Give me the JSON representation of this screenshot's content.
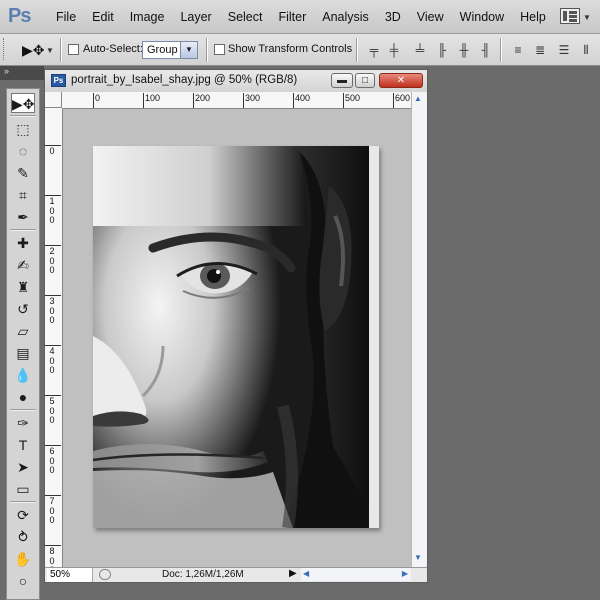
{
  "app": {
    "logo": "Ps"
  },
  "menu": [
    "File",
    "Edit",
    "Image",
    "Layer",
    "Select",
    "Filter",
    "Analysis",
    "3D",
    "View",
    "Window",
    "Help"
  ],
  "options": {
    "auto_select_label": "Auto-Select:",
    "auto_select_value": "Group",
    "transform_label": "Show Transform Controls",
    "auto_select_checked": false,
    "transform_checked": false
  },
  "document": {
    "badge": "Ps",
    "title": "portrait_by_Isabel_shay.jpg @ 50% (RGB/8)",
    "minimize": "▬",
    "maximize": "□",
    "close": "✕",
    "ruler_h": [
      "0",
      "100",
      "200",
      "300",
      "400",
      "500",
      "600"
    ],
    "ruler_v": [
      "0",
      "1 0 0",
      "2 0 0",
      "3 0 0",
      "4 0 0",
      "5 0 0",
      "6 0 0",
      "7 0 0",
      "8 0 0"
    ],
    "zoom": "50%",
    "doc_size": "Doc: 1,26M/1,26M"
  },
  "toolbox": {
    "collapse": "»",
    "tools": [
      "move-tool",
      "marquee-tool",
      "lasso-tool",
      "quick-selection-tool",
      "crop-tool",
      "eyedropper-tool",
      "healing-brush-tool",
      "brush-tool",
      "clone-stamp-tool",
      "history-brush-tool",
      "eraser-tool",
      "gradient-tool",
      "blur-tool",
      "dodge-tool",
      "pen-tool",
      "type-tool",
      "path-selection-tool",
      "rectangle-tool",
      "3d-rotate-tool",
      "3d-orbit-tool",
      "hand-tool",
      "zoom-tool"
    ],
    "type_glyph": "T"
  },
  "colors": {
    "accent": "#2b5aa4",
    "workspace": "#6b6b6b",
    "canvas_bg": "#c0c0c0"
  }
}
